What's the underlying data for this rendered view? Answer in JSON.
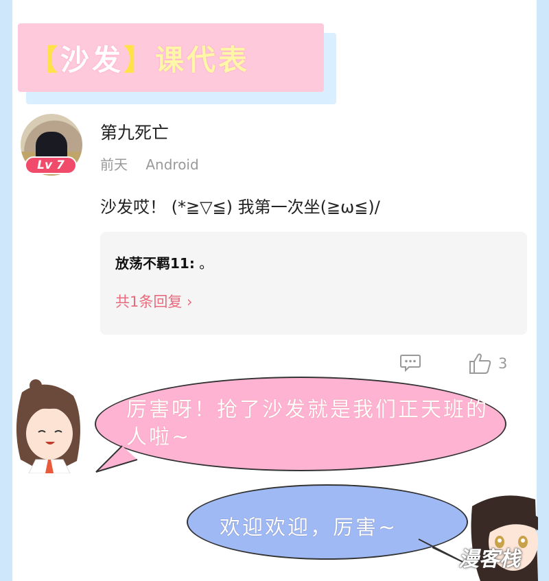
{
  "header": {
    "title_bracket_open": "【",
    "title_word": "沙发",
    "title_bracket_close": "】",
    "title_suffix": "课代表"
  },
  "comment": {
    "level_badge": "Lv 7",
    "username": "第九死亡",
    "time": "前天",
    "platform": "Android",
    "content": "沙发哎！ (*≧▽≦) 我第一次坐(≧ω≦)/",
    "reply_preview": {
      "author": "放荡不羁11:",
      "text": "。"
    },
    "reply_count_label": "共1条回复",
    "like_count": "3"
  },
  "dialog": {
    "pink_bubble": "厉害呀！抢了沙发就是我们正天班的人啦~",
    "blue_bubble": "欢迎欢迎，厉害~"
  },
  "watermark": "漫客栈",
  "colors": {
    "banner_bg": "#ffc9dc",
    "level_badge": "#f04b6a",
    "reply_link": "#e86a7c",
    "pink_bubble": "#ffb3d2",
    "blue_bubble": "#9fb9f5"
  }
}
